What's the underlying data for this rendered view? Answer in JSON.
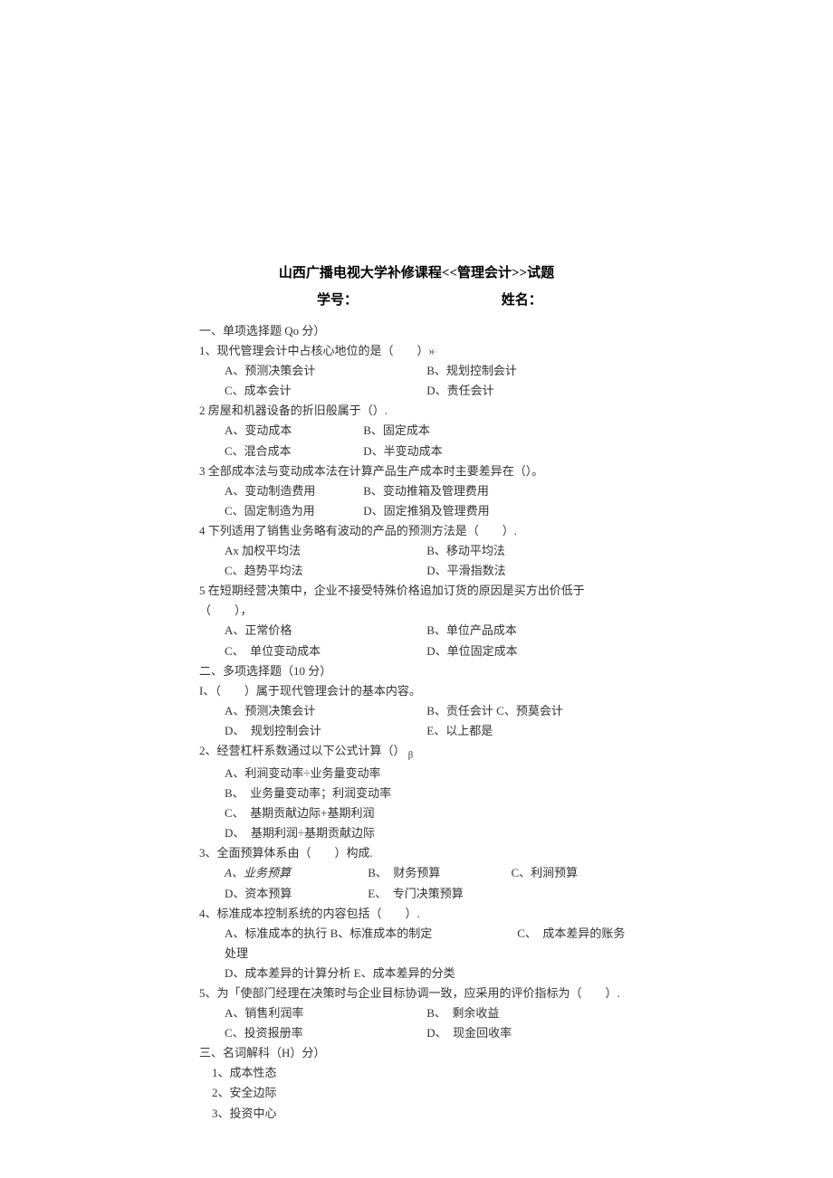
{
  "title": "山西广播电视大学补修课程<<管理会计>>试题",
  "fields": {
    "id_label": "学号：",
    "name_label": "姓名："
  },
  "section1": {
    "heading": "一、单项选择题 Qo 分）",
    "q1": {
      "stem": "1、现代管理会计中占核心地位的是（　　）»",
      "A": "A、预测决策会计",
      "B": "B、规划控制会计",
      "C": "C、成本会计",
      "D": "D、责任会计"
    },
    "q2": {
      "stem": "2 房屋和机器设备的折旧般属于（）.",
      "A": "A、变动成本",
      "B": "B、固定成本",
      "C": "C、混合成本",
      "D": "D、半变动成本"
    },
    "q3": {
      "stem": "3 全部成本法与变动成本法在计算产品生产成本时主要差异在（）。",
      "A": "A、变动制造费用",
      "B": "B、变动推箱及管理费用",
      "C": "C、固定制造为用",
      "D": "D、固定推狷及管理费用"
    },
    "q4": {
      "stem": "4 下列适用了销售业务略有波动的产品的预测方法是（　　）.",
      "A": "Ax 加权平均法",
      "B": "B、移动平均法",
      "C": "C、趋势平均法",
      "D": "D、平滑指数法"
    },
    "q5": {
      "stem": "5 在短期经营决策中，企业不接受特殊价格追加订货的原因是买方出价低于（　　），",
      "A": "A、正常价格",
      "B": "B、单位产品成本",
      "C": "C、　单位变动成本",
      "D": "D、单位固定成本"
    }
  },
  "section2": {
    "heading": "二、多项选择题（10 分）",
    "q1": {
      "stem": "I、（　　）属于现代管理会计的基本内容。",
      "A": "A、预测决策会计",
      "B": "B、贡任会计 C、预莫会计",
      "D": "D、　规划控制会计",
      "E": "E、以上都是"
    },
    "q2": {
      "stem": "2、经营杠杆系数通过以下公式计算（）",
      "sub": "β",
      "A": "A、利涧变动率÷业务量变动率",
      "B": "B、　业务量变动率；利润变动率",
      "C": "C、　基期贡献边际+基期利润",
      "D": "D、　基期利润÷基期贡献边际"
    },
    "q3": {
      "stem": "3、全面预算体系由（　　）构成.",
      "A": "A、业务预算",
      "B": "B、　财务预算",
      "C": "C、利涧预算",
      "D": "D、资本预算",
      "E": "E、　专门决策预算"
    },
    "q4": {
      "stem": "4、标准成本控制系统的内容包括（　　）.",
      "A": "A、标准成本的执行 B、标准成本的制定",
      "C": "C、　成本差异的账务处理",
      "D": "D、成本差异的计算分析 E、成本差异的分类"
    },
    "q5": {
      "stem": "5、为「使部门经理在决策时与企业目标协调一致，应采用的评价指标为（　　）.",
      "A": "A、销售利润率",
      "B": "B、　剩余收益",
      "C": "C、投资报册率",
      "D": "D、　现金回收率"
    }
  },
  "section3": {
    "heading": "三、名词解科（H）分）",
    "t1": "1、成本性态",
    "t2": "2、安全边际",
    "t3": "3、投资中心"
  }
}
